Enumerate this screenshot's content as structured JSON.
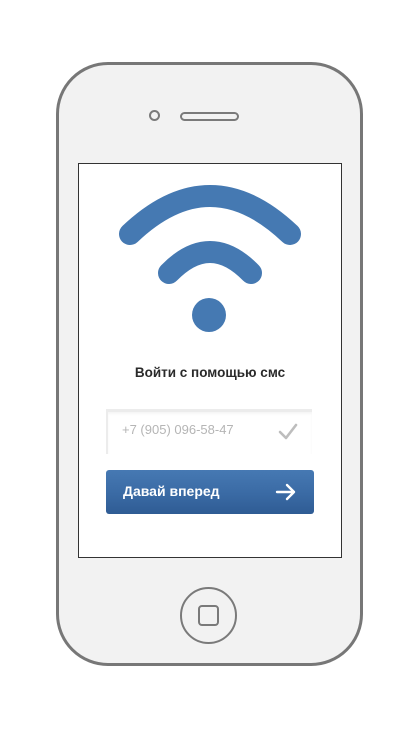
{
  "login": {
    "title": "Войти с помощью смс",
    "phone_placeholder": "+7 (905) 096-58-47",
    "submit_label": "Давай вперед"
  },
  "icons": {
    "wifi": "wifi-icon",
    "check": "check-icon",
    "arrow": "arrow-right-icon",
    "home": "home-button-icon"
  },
  "colors": {
    "accent": "#4579b2",
    "button_dark": "#2f5c94",
    "frame": "#777777",
    "placeholder": "#b5b5b5"
  }
}
